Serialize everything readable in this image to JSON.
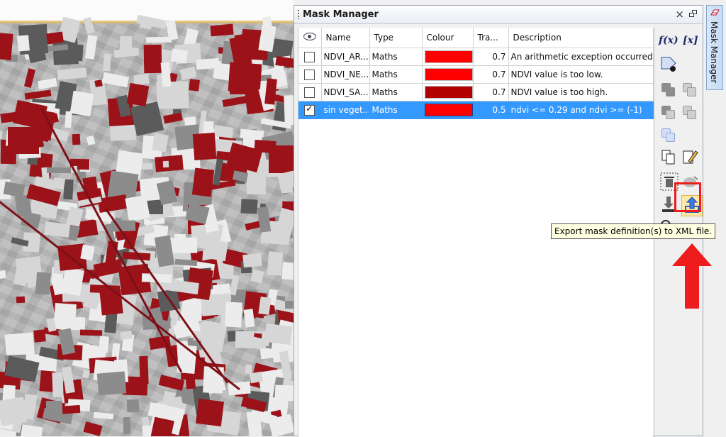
{
  "panel": {
    "title": "Mask Manager",
    "close_glyph": "×"
  },
  "table": {
    "columns": [
      "",
      "Name",
      "Type",
      "Colour",
      "Tra...",
      "Description"
    ],
    "rows": [
      {
        "checked": false,
        "name": "NDVI_AR...",
        "type": "Maths",
        "colour": "#ff0000",
        "transparency": "0.7",
        "description": "An arithmetic exception occurred."
      },
      {
        "checked": false,
        "name": "NDVI_NE...",
        "type": "Maths",
        "colour": "#ff0000",
        "transparency": "0.7",
        "description": "NDVI value is too low."
      },
      {
        "checked": false,
        "name": "NDVI_SA...",
        "type": "Maths",
        "colour": "#b20000",
        "transparency": "0.7",
        "description": "NDVI value is too high."
      },
      {
        "checked": true,
        "name": "sin veget...",
        "type": "Maths",
        "colour": "#ff0000",
        "transparency": "0.5",
        "description": "ndvi <= 0.29 and ndvi >= (-1)",
        "selected": true
      }
    ]
  },
  "toolbar": {
    "fx_label": "f(x)",
    "vector_label": "[x]",
    "icons": [
      "f-of-x-icon",
      "vector-mask-icon",
      "range-mask-icon",
      "union-icon",
      "intersection-icon",
      "difference-icon",
      "complement-icon",
      "invert-icon",
      "copy-mask-icon",
      "edit-mask-icon",
      "delete-mask-icon",
      "transfer-mask-icon",
      "import-mask-icon",
      "export-mask-icon",
      "magic-wand-icon"
    ]
  },
  "tooltip": {
    "text": "Export mask definition(s) to XML file."
  },
  "side_tab": {
    "label": "Mask Manager"
  },
  "colors": {
    "selection": "#3399ff",
    "highlight_box": "#ee1c1c",
    "mask_red": "#9b1219"
  }
}
